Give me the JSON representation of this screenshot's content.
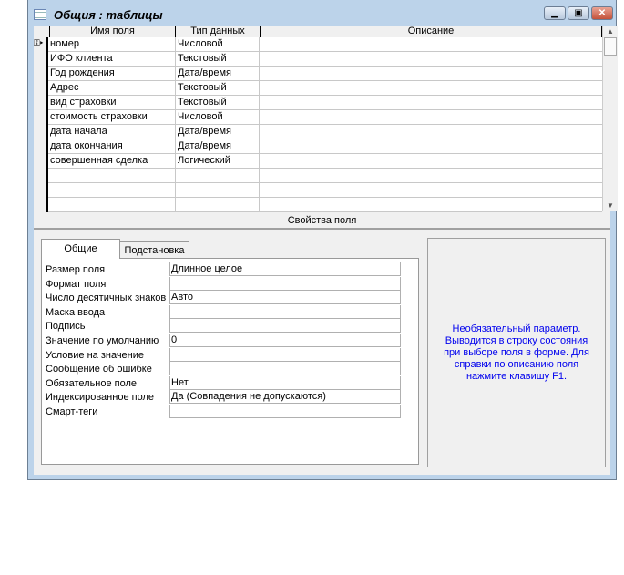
{
  "window": {
    "title": "Общия : таблицы"
  },
  "grid": {
    "headers": [
      "Имя поля",
      "Тип данных",
      "Описание"
    ],
    "rows": [
      {
        "name": "номер",
        "type": "Числовой",
        "key": true
      },
      {
        "name": "ИФО клиента",
        "type": "Текстовый"
      },
      {
        "name": "Год рождения",
        "type": "Дата/время"
      },
      {
        "name": "Адрес",
        "type": "Текстовый"
      },
      {
        "name": "вид страховки",
        "type": "Текстовый"
      },
      {
        "name": "стоимость страховки",
        "type": "Числовой"
      },
      {
        "name": "дата начала",
        "type": "Дата/время"
      },
      {
        "name": "дата окончания",
        "type": "Дата/время"
      },
      {
        "name": "совершенная сделка",
        "type": "Логический"
      }
    ]
  },
  "properties": {
    "title": "Свойства поля",
    "tabs": [
      "Общие",
      "Подстановка"
    ],
    "items": [
      {
        "label": "Размер поля",
        "value": "Длинное целое"
      },
      {
        "label": "Формат поля",
        "value": ""
      },
      {
        "label": "Число десятичных знаков",
        "value": "Авто"
      },
      {
        "label": "Маска ввода",
        "value": ""
      },
      {
        "label": "Подпись",
        "value": ""
      },
      {
        "label": "Значение по умолчанию",
        "value": "0"
      },
      {
        "label": "Условие на значение",
        "value": ""
      },
      {
        "label": "Сообщение об ошибке",
        "value": ""
      },
      {
        "label": "Обязательное поле",
        "value": "Нет"
      },
      {
        "label": "Индексированное поле",
        "value": "Да (Совпадения не допускаются)"
      },
      {
        "label": "Смарт-теги",
        "value": ""
      }
    ],
    "help": "Необязательный параметр. Выводится в строку состояния при выборе поля в форме. Для справки по описанию поля нажмите клавишу F1."
  }
}
